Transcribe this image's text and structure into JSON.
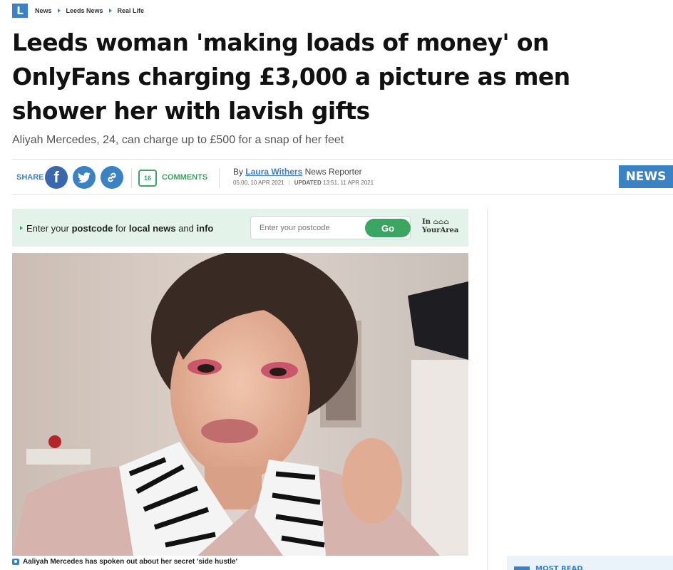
{
  "breadcrumb": {
    "logo": "L",
    "items": [
      "News",
      "Leeds News",
      "Real Life"
    ]
  },
  "article": {
    "headline": "Leeds woman 'making loads of money' on OnlyFans charging £3,000 a picture as men shower her with lavish gifts",
    "standfirst": "Aliyah Mercedes, 24, can charge up to £500 for a snap of her feet"
  },
  "share": {
    "label": "SHARE",
    "facebook_icon": "facebook-icon",
    "twitter_icon": "twitter-icon",
    "link_icon": "link-icon",
    "comment_count": "16",
    "comments_label": "COMMENTS"
  },
  "byline": {
    "prefix": "By",
    "author": "Laura Withers",
    "role": "News Reporter",
    "published": "05:00, 10 APR 2021",
    "updated_label": "UPDATED",
    "updated": "13:51, 11 APR 2021"
  },
  "section_badge": "NEWS",
  "postcode": {
    "t1": "Enter your",
    "t2": "postcode",
    "t3": "for",
    "t4": "local news",
    "t5": "and",
    "t6": "info",
    "placeholder": "Enter your postcode",
    "go_label": "Go",
    "brand_in": "In",
    "brand_name": "YourArea"
  },
  "image": {
    "caption": "Aaliyah Mercedes has spoken out about her secret 'side hustle'"
  },
  "sidebar": {
    "most_read": "MOST READ"
  },
  "colors": {
    "brand_blue": "#3b82c4",
    "green": "#3aa661",
    "facebook": "#3b67ac",
    "postcode_bg": "#e4f3e9"
  }
}
